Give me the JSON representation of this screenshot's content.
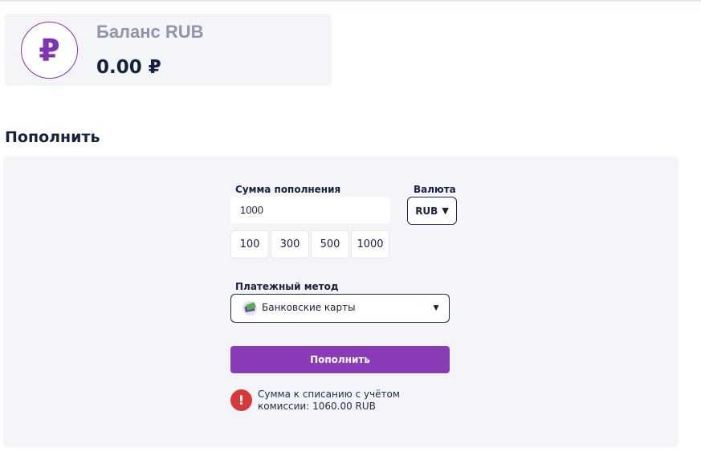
{
  "balance": {
    "currency_symbol": "₽",
    "label": "Баланс RUB",
    "amount": "0.00 ₽"
  },
  "topup": {
    "section_title": "Пополнить",
    "amount_label": "Сумма пополнения",
    "amount_value": "1000",
    "currency_label": "Валюта",
    "currency_value": "RUB",
    "presets": [
      "100",
      "300",
      "500",
      "1000"
    ],
    "method_label": "Платежный метод",
    "method_value": "Банковские карты",
    "submit_label": "Пополнить",
    "notice_line1": "Сумма к списанию с учётом",
    "notice_line2": "комиссии: 1060.00 RUB"
  },
  "icons": {
    "alert": "!",
    "caret": "▼"
  },
  "colors": {
    "accent": "#8a3bb8",
    "alert": "#d53a3a"
  }
}
